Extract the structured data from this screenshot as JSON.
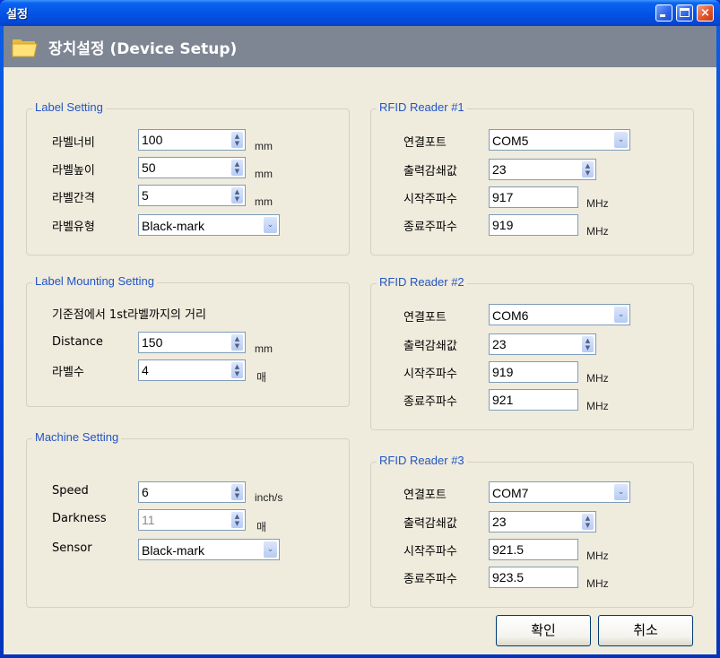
{
  "window": {
    "title": "설정",
    "controls": {
      "minimize": "minimize",
      "maximize": "maximize",
      "close": "×"
    }
  },
  "header": {
    "title": "장치설정 (Device Setup)",
    "icon": "folder-open-icon"
  },
  "label_setting": {
    "legend": "Label Setting",
    "width": {
      "label": "라벨너비",
      "value": "100",
      "unit": "mm"
    },
    "height": {
      "label": "라벨높이",
      "value": "50",
      "unit": "mm"
    },
    "gap": {
      "label": "라벨간격",
      "value": "5",
      "unit": "mm"
    },
    "type": {
      "label": "라벨유형",
      "value": "Black-mark"
    }
  },
  "label_mounting": {
    "legend": "Label Mounting Setting",
    "description": "기준점에서 1st라벨까지의 거리",
    "distance": {
      "label": "Distance",
      "value": "150",
      "unit": "mm"
    },
    "count": {
      "label": "라벨수",
      "value": "4",
      "unit": "매"
    }
  },
  "machine_setting": {
    "legend": "Machine Setting",
    "speed": {
      "label": "Speed",
      "value": "6",
      "unit": "inch/s"
    },
    "darkness": {
      "label": "Darkness",
      "value": "11",
      "unit": "매",
      "disabled": true
    },
    "sensor": {
      "label": "Sensor",
      "value": "Black-mark"
    }
  },
  "readers": [
    {
      "legend": "RFID Reader #1",
      "port_label": "연결포트",
      "port": "COM5",
      "atten_label": "출력감쇄값",
      "atten": "23",
      "start_label": "시작주파수",
      "start": "917",
      "end_label": "종료주파수",
      "end": "919",
      "unit": "MHz"
    },
    {
      "legend": "RFID Reader #2",
      "port_label": "연결포트",
      "port": "COM6",
      "atten_label": "출력감쇄값",
      "atten": "23",
      "start_label": "시작주파수",
      "start": "919",
      "end_label": "종료주파수",
      "end": "921",
      "unit": "MHz"
    },
    {
      "legend": "RFID Reader #3",
      "port_label": "연결포트",
      "port": "COM7",
      "atten_label": "출력감쇄값",
      "atten": "23",
      "start_label": "시작주파수",
      "start": "921.5",
      "end_label": "종료주파수",
      "end": "923.5",
      "unit": "MHz"
    }
  ],
  "buttons": {
    "ok": "확인",
    "cancel": "취소"
  },
  "icons": {
    "spin_up": "▲",
    "spin_down": "▼",
    "dropdown": "⌄"
  }
}
